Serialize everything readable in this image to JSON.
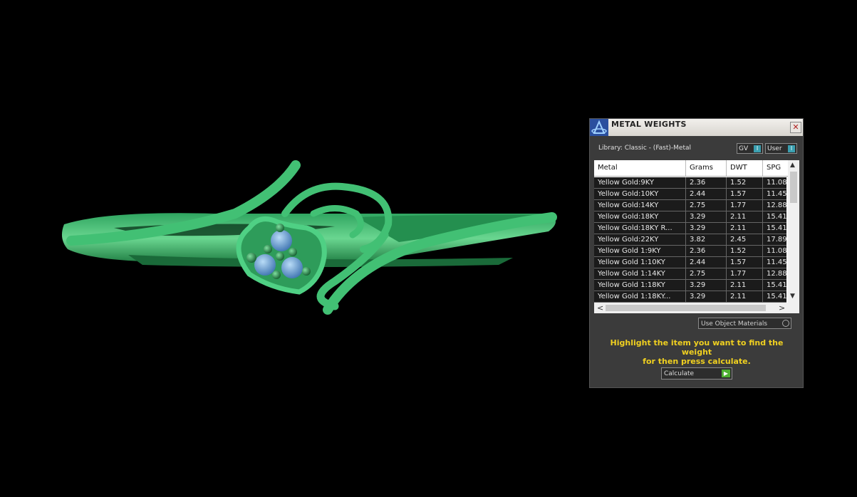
{
  "panel": {
    "title": "METAL WEIGHTS",
    "close_label": "✕",
    "library": "Library: Classic - (Fast)-Metal",
    "toggles": {
      "gv": "GV",
      "user": "User"
    },
    "use_object_materials": "Use Object Materials",
    "hint_line1": "Highlight the item you want to find the weight",
    "hint_line2": "for then press calculate.",
    "calculate_label": "Calculate"
  },
  "table": {
    "columns": [
      "Metal",
      "Grams",
      "DWT",
      "SPG"
    ],
    "rows": [
      [
        "Yellow Gold:9KY",
        "2.36",
        "1.52",
        "11.08"
      ],
      [
        "Yellow Gold:10KY",
        "2.44",
        "1.57",
        "11.45"
      ],
      [
        "Yellow Gold:14KY",
        "2.75",
        "1.77",
        "12.88"
      ],
      [
        "Yellow Gold:18KY",
        "3.29",
        "2.11",
        "15.41"
      ],
      [
        "Yellow Gold:18KY R...",
        "3.29",
        "2.11",
        "15.41"
      ],
      [
        "Yellow Gold:22KY",
        "3.82",
        "2.45",
        "17.89"
      ],
      [
        "Yellow Gold 1:9KY",
        "2.36",
        "1.52",
        "11.08"
      ],
      [
        "Yellow Gold 1:10KY",
        "2.44",
        "1.57",
        "11.45"
      ],
      [
        "Yellow Gold 1:14KY",
        "2.75",
        "1.77",
        "12.88"
      ],
      [
        "Yellow Gold 1:18KY",
        "3.29",
        "2.11",
        "15.41"
      ],
      [
        "Yellow Gold 1:18KY...",
        "3.29",
        "2.11",
        "15.41"
      ]
    ]
  },
  "colors": {
    "ring": "#2fa560",
    "stone": "#6fa6d6",
    "hint": "#f0d020"
  }
}
